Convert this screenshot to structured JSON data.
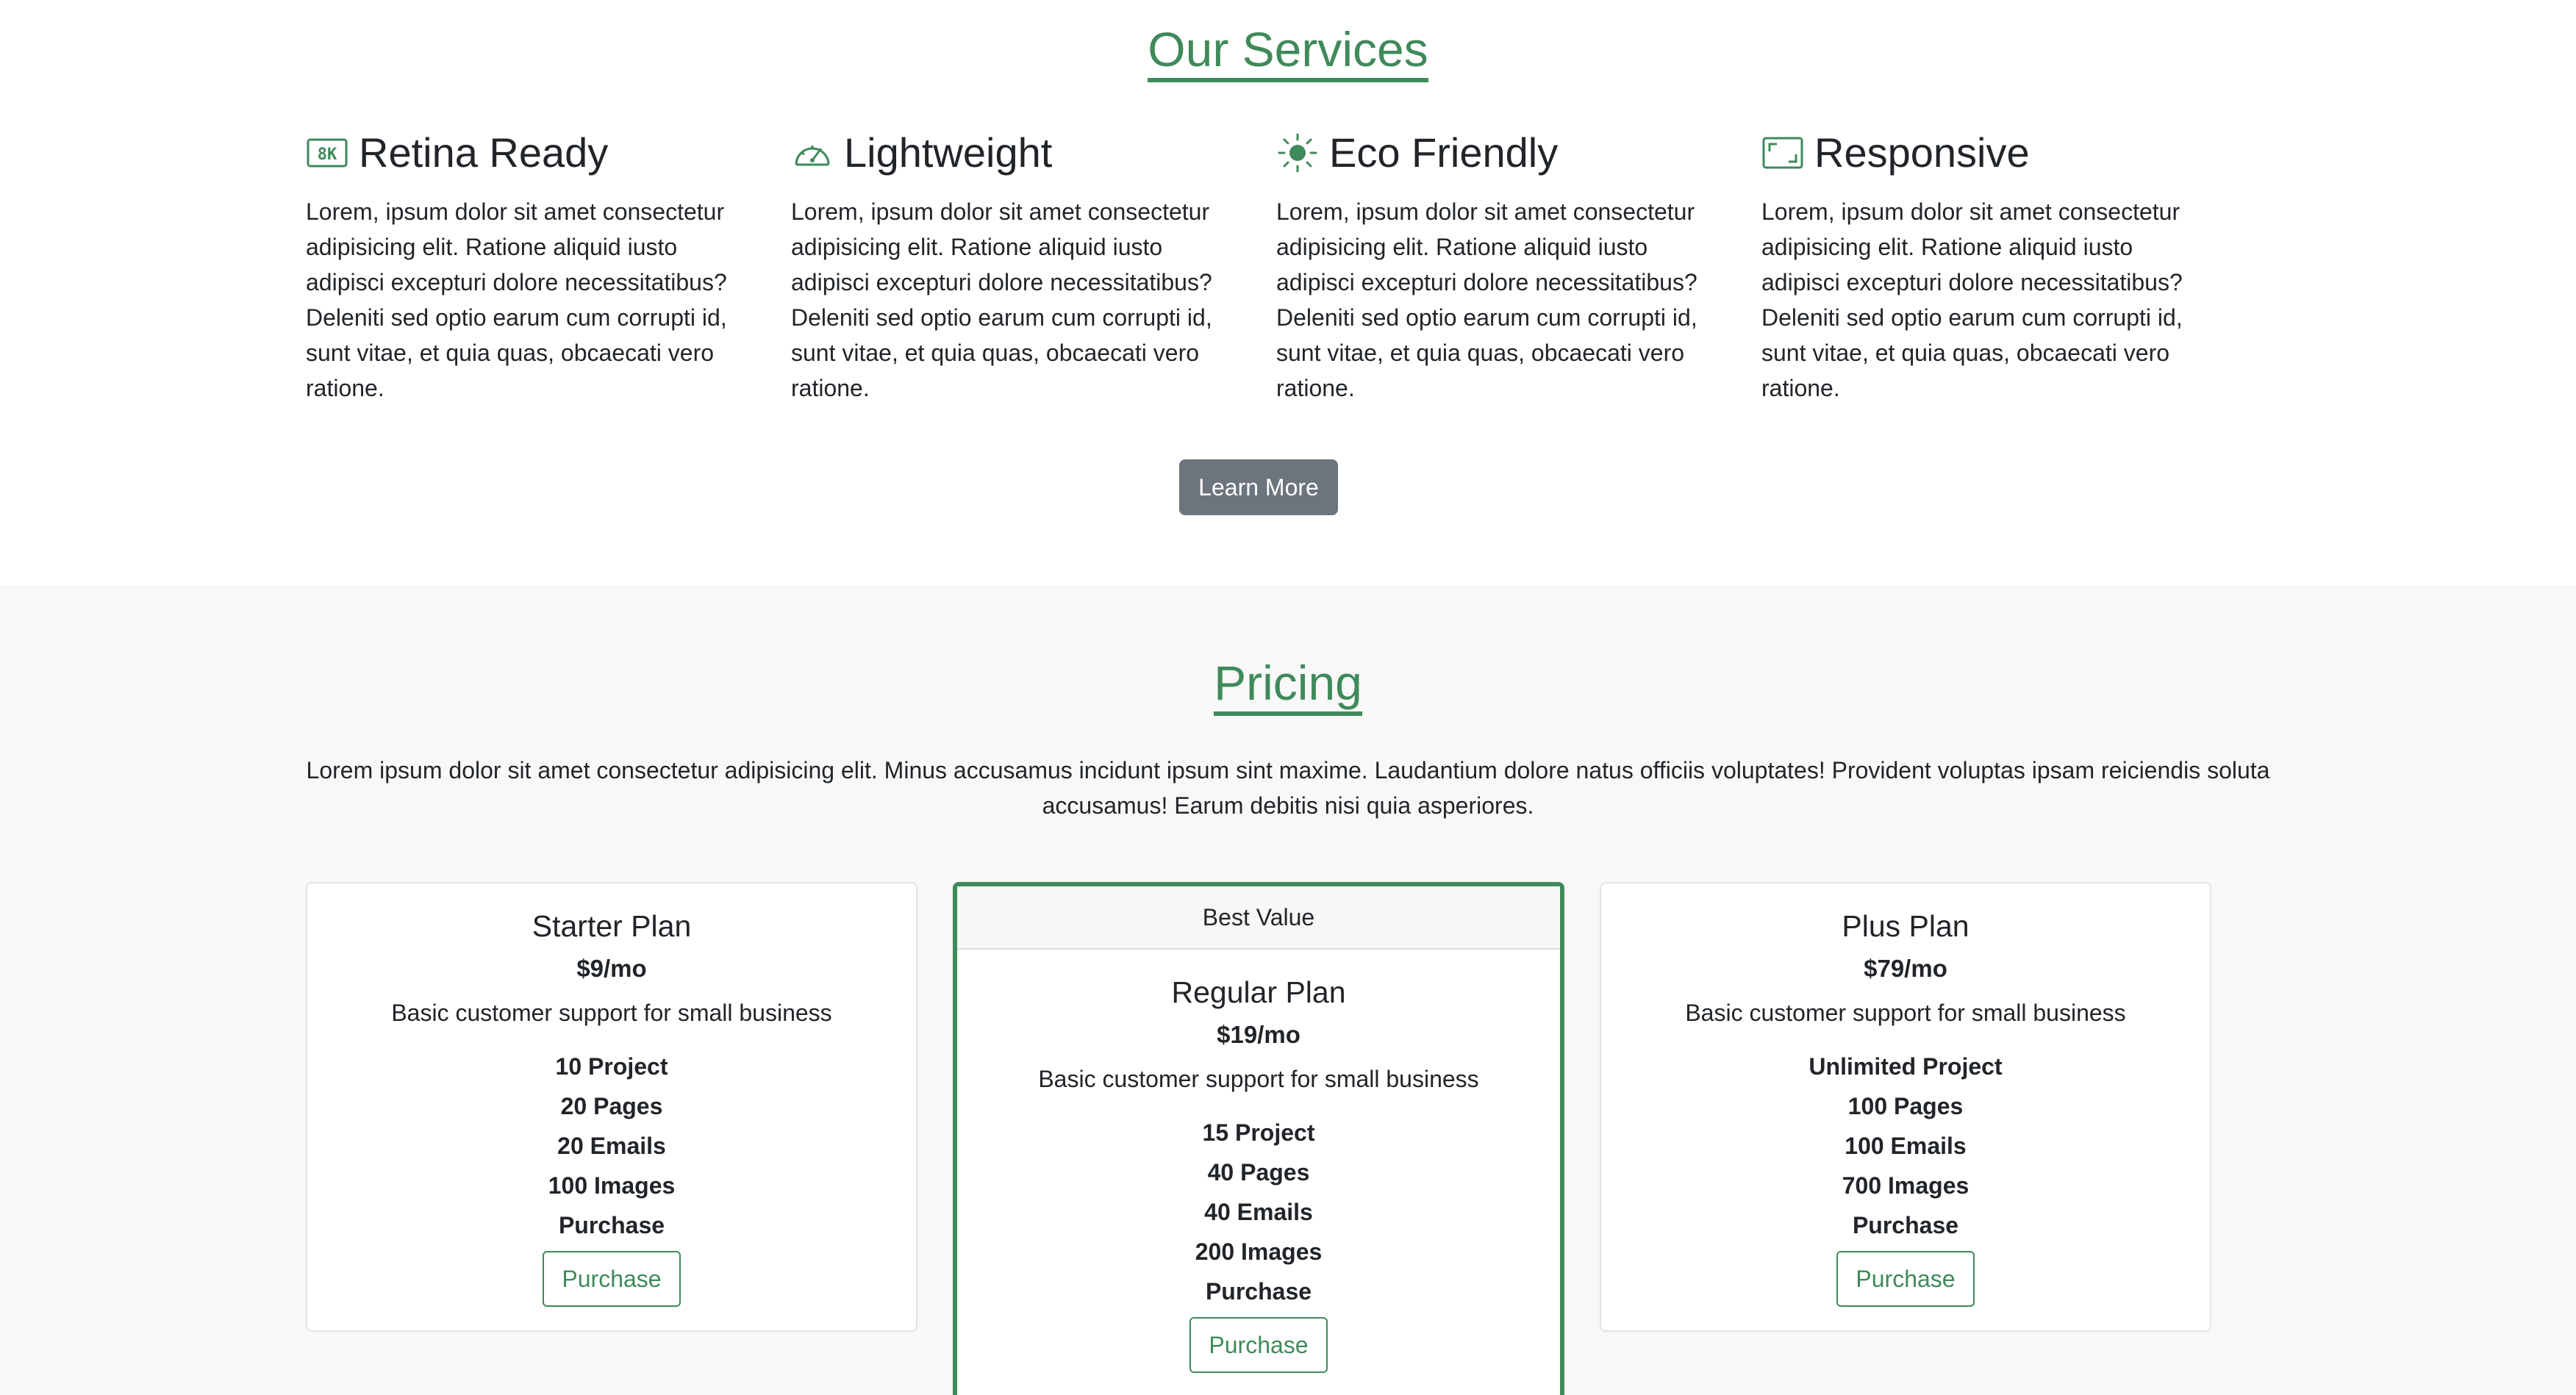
{
  "services": {
    "title": "Our Services",
    "features": [
      {
        "icon": "8k-icon",
        "title": "Retina Ready",
        "text": "Lorem, ipsum dolor sit amet consectetur adipisicing elit. Ratione aliquid iusto adipisci excepturi dolore necessitatibus? Deleniti sed optio earum cum corrupti id, sunt vitae, et quia quas, obcaecati vero ratione."
      },
      {
        "icon": "speedometer-icon",
        "title": "Lightweight",
        "text": "Lorem, ipsum dolor sit amet consectetur adipisicing elit. Ratione aliquid iusto adipisci excepturi dolore necessitatibus? Deleniti sed optio earum cum corrupti id, sunt vitae, et quia quas, obcaecati vero ratione."
      },
      {
        "icon": "sun-icon",
        "title": "Eco Friendly",
        "text": "Lorem, ipsum dolor sit amet consectetur adipisicing elit. Ratione aliquid iusto adipisci excepturi dolore necessitatibus? Deleniti sed optio earum cum corrupti id, sunt vitae, et quia quas, obcaecati vero ratione."
      },
      {
        "icon": "aspect-ratio-icon",
        "title": "Responsive",
        "text": "Lorem, ipsum dolor sit amet consectetur adipisicing elit. Ratione aliquid iusto adipisci excepturi dolore necessitatibus? Deleniti sed optio earum cum corrupti id, sunt vitae, et quia quas, obcaecati vero ratione."
      }
    ],
    "learn_more_label": "Learn More"
  },
  "pricing": {
    "title": "Pricing",
    "lead": "Lorem ipsum dolor sit amet consectetur adipisicing elit. Minus accusamus incidunt ipsum sint maxime. Laudantium dolore natus officiis voluptates! Provident voluptas ipsam reiciendis soluta accusamus! Earum debitis nisi quia asperiores.",
    "plans": [
      {
        "name": "Starter Plan",
        "price": "$9/mo",
        "description": "Basic customer support for small business",
        "features": [
          "10 Project",
          "20 Pages",
          "20 Emails",
          "100 Images",
          "Purchase"
        ],
        "button_label": "Purchase"
      },
      {
        "badge": "Best Value",
        "name": "Regular Plan",
        "price": "$19/mo",
        "description": "Basic customer support for small business",
        "features": [
          "15 Project",
          "40 Pages",
          "40 Emails",
          "200 Images",
          "Purchase"
        ],
        "button_label": "Purchase"
      },
      {
        "name": "Plus Plan",
        "price": "$79/mo",
        "description": "Basic customer support for small business",
        "features": [
          "Unlimited Project",
          "100 Pages",
          "100 Emails",
          "700 Images",
          "Purchase"
        ],
        "button_label": "Purchase"
      }
    ]
  },
  "colors": {
    "accent": "#3f8a5a",
    "secondary_button": "#6c757d",
    "pricing_background": "#f8f8f8"
  }
}
